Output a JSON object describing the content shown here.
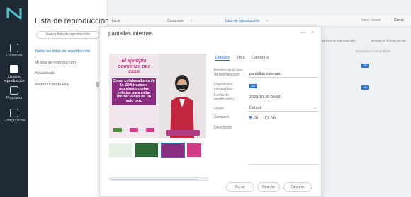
{
  "rail": {
    "items": [
      {
        "label": "Contenido"
      },
      {
        "label": "Lista de reproducción"
      },
      {
        "label": "Programa"
      },
      {
        "label": "Configuración"
      }
    ]
  },
  "library": {
    "title": "Lista de reproducción",
    "new_button": "Nueva lista de reproducción",
    "items": [
      {
        "label": "Todas las listas de reproducción"
      },
      {
        "label": "Mi lista de reproducción"
      },
      {
        "label": "Actualizado"
      },
      {
        "label": "Reproduciendo Hoy"
      }
    ]
  },
  "tabs": [
    {
      "label": "Inicio"
    },
    {
      "label": "Contenido"
    },
    {
      "label": "Lista de reproducción"
    }
  ],
  "header": {
    "btn_light": "Inicio sesión",
    "btn_dark": "Cerrar"
  },
  "rightlist": {
    "col1": "de lista de reproducción",
    "col2": "Buscar en la lista de rep.",
    "sub": "Dispositivos compatibles",
    "badge": "HD"
  },
  "modal": {
    "title": "pantallas internas",
    "close": "×",
    "minimize": "—",
    "preview": {
      "headline": "El ejemplo comienza por casa",
      "body": "Como colaboradores de la SDA traemos nuestras propias policías para evitar utilizar vasos de un solo uso."
    },
    "tabs": [
      {
        "label": "Detalles"
      },
      {
        "label": "Vista"
      },
      {
        "label": "Categoría"
      }
    ],
    "fields": {
      "name_label": "Nombre de la lista de reproducción",
      "name_value": "pantallas internas",
      "devices_label": "Dispositivos compatibles",
      "date_label": "Fecha de modificación",
      "date_value": "2023-10-20 09:58",
      "group_label": "Grupo",
      "group_value": "Default",
      "share_label": "Compartir",
      "share_yes": "Sí",
      "share_no": "No",
      "desc_label": "Descripción"
    },
    "buttons": {
      "delete": "Borrar",
      "save": "Guardar",
      "cancel": "Cancelar"
    }
  }
}
